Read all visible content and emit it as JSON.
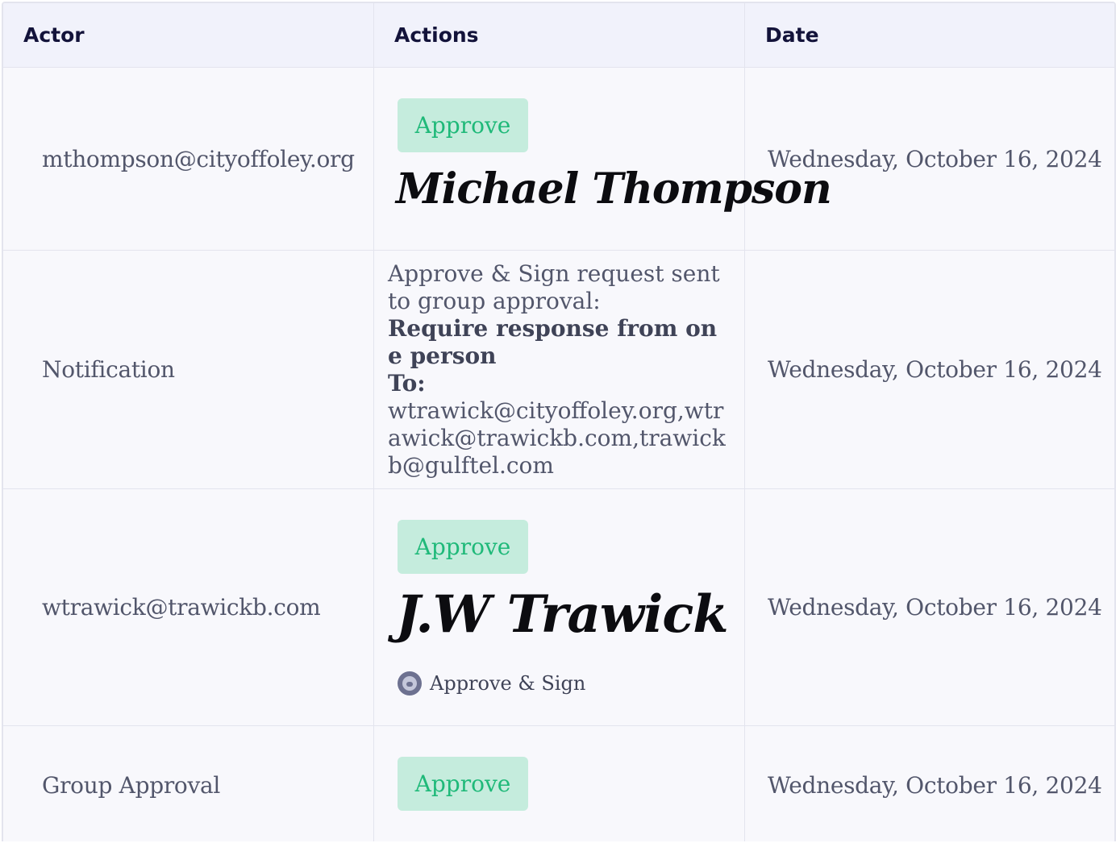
{
  "columns": {
    "actor": "Actor",
    "actions": "Actions",
    "date": "Date"
  },
  "rows": [
    {
      "actor": "mthompson@cityoffoley.org",
      "action_label": "Approve",
      "signature": "Michael Thompson",
      "date": "Wednesday, October 16, 2024"
    },
    {
      "actor": "Notification",
      "notification": {
        "text": "Approve & Sign request sent to group approval:",
        "bold_line": "Require response from one person",
        "to_label": "To:",
        "recipients": "wtrawick@cityoffoley.org,wtrawick@trawickb.com,trawickb@gulftel.com"
      },
      "date": "Wednesday, October 16, 2024"
    },
    {
      "actor": "wtrawick@trawickb.com",
      "action_label": "Approve",
      "signature": "J.W Trawick",
      "tag_label": "Approve & Sign",
      "date": "Wednesday, October 16, 2024"
    },
    {
      "actor": "Group Approval",
      "action_label": "Approve",
      "date": "Wednesday, October 16, 2024"
    }
  ]
}
